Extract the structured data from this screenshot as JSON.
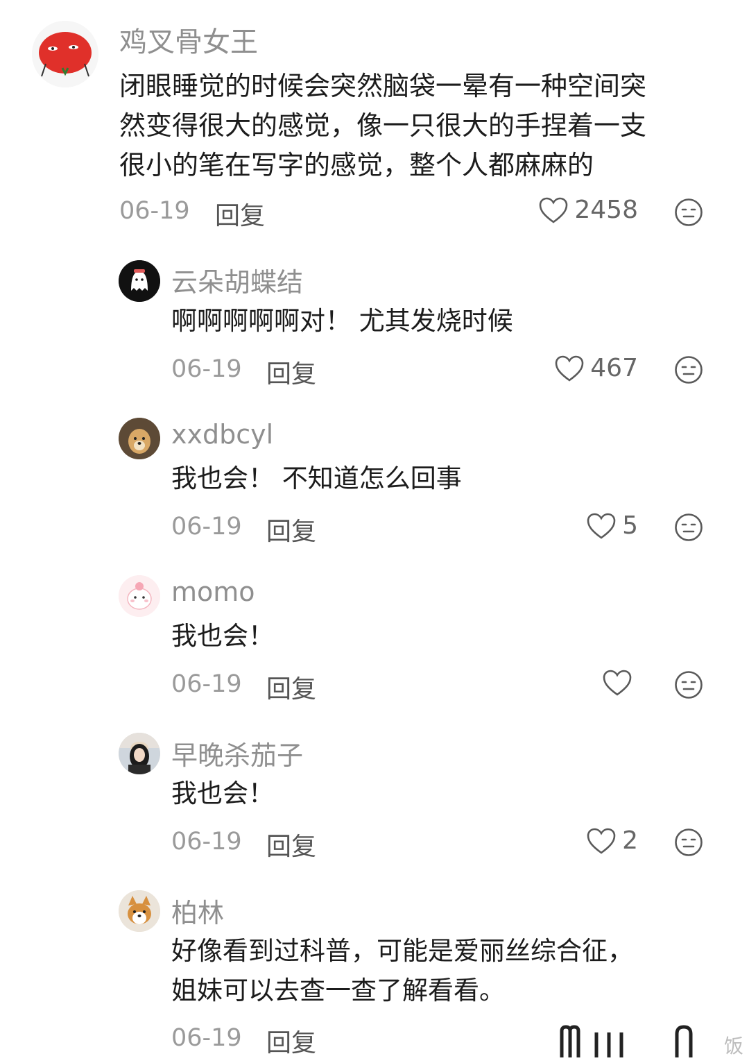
{
  "comments": [
    {
      "username": "鸡叉骨女王",
      "text": "闭眼睡觉的时候会突然脑袋一晕有一种空间突\n然变得很大的感觉，像一只很大的手捏着一支\n很小的笔在写字的感觉，整个人都麻麻的",
      "date": "06-19",
      "reply_label": "回复",
      "likes": "2458",
      "avatar": "red-tomato-avatar"
    }
  ],
  "replies": [
    {
      "username": "云朵胡蝶结",
      "text": "啊啊啊啊啊对！ 尤其发烧时候",
      "date": "06-19",
      "reply_label": "回复",
      "likes": "467",
      "avatar": "ghost-avatar"
    },
    {
      "username": "xxdbcyl",
      "text": "我也会！ 不知道怎么回事",
      "date": "06-19",
      "reply_label": "回复",
      "likes": "5",
      "avatar": "dog-avatar"
    },
    {
      "username": "momo",
      "text": "我也会！",
      "date": "06-19",
      "reply_label": "回复",
      "likes": "",
      "avatar": "pink-creature-avatar"
    },
    {
      "username": "早晚杀茄子",
      "text": "我也会！",
      "date": "06-19",
      "reply_label": "回复",
      "likes": "2",
      "avatar": "girl-avatar"
    },
    {
      "username": "柏林",
      "text": "好像看到过科普，可能是爱丽丝综合征，\n姐妹可以去查一查了解看看。",
      "date": "06-19",
      "reply_label": "回复",
      "likes": "",
      "avatar": "corgi-avatar"
    }
  ],
  "watermark": "饭",
  "colors": {
    "username": "#8f8f8f",
    "text": "#1c1c1c",
    "meta": "#9a9a9a",
    "icon": "#5a5a5a"
  }
}
